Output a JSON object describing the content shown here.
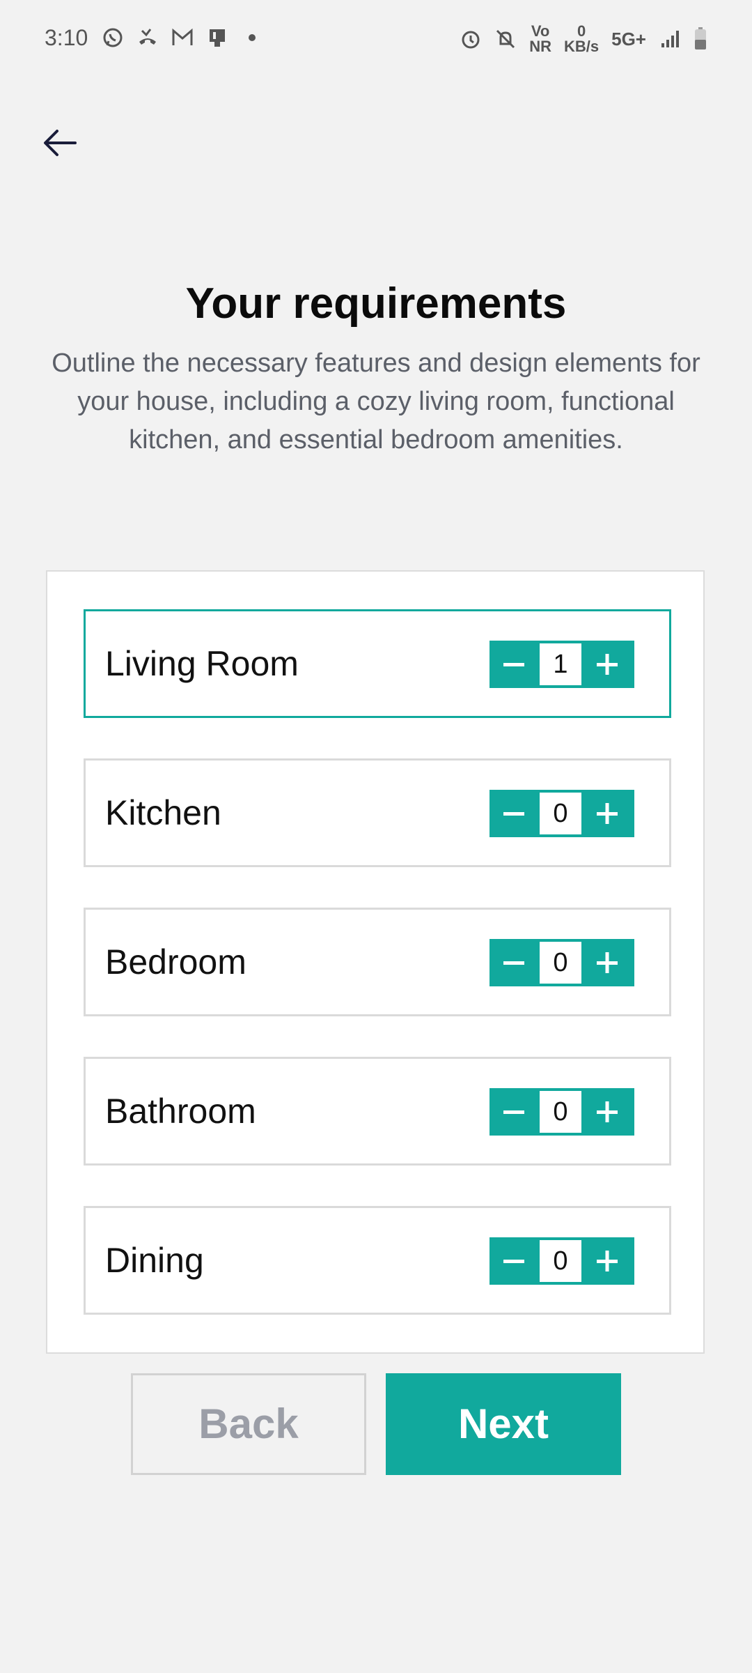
{
  "status_bar": {
    "time": "3:10",
    "left_icons": [
      "whatsapp-icon",
      "missed-call-icon",
      "gmail-icon",
      "device-icon",
      "dot-icon"
    ],
    "right_icons": [
      "alarm-icon",
      "bell-off-icon",
      "volte-icon",
      "data-speed-icon",
      "network-icon",
      "signal-icon",
      "battery-icon"
    ],
    "vo_nr": "Vo\nNR",
    "data_speed": "0\nKB/s",
    "network": "5G+"
  },
  "header": {
    "back_icon": "arrow-left-icon"
  },
  "page": {
    "title": "Your requirements",
    "subtitle": "Outline the necessary features and design elements for your house, including a cozy living room, functional kitchen, and essential bedroom amenities."
  },
  "rooms": [
    {
      "label": "Living Room",
      "count": "1",
      "active": true
    },
    {
      "label": "Kitchen",
      "count": "0",
      "active": false
    },
    {
      "label": "Bedroom",
      "count": "0",
      "active": false
    },
    {
      "label": "Bathroom",
      "count": "0",
      "active": false
    },
    {
      "label": "Dining",
      "count": "0",
      "active": false
    }
  ],
  "stepper_icons": {
    "decrement": "minus-icon",
    "increment": "plus-icon"
  },
  "actions": {
    "back_label": "Back",
    "next_label": "Next"
  },
  "colors": {
    "accent": "#11a99d",
    "background": "#f2f2f2",
    "text_muted": "#5b5f68",
    "disabled_text": "#9b9ea7"
  }
}
